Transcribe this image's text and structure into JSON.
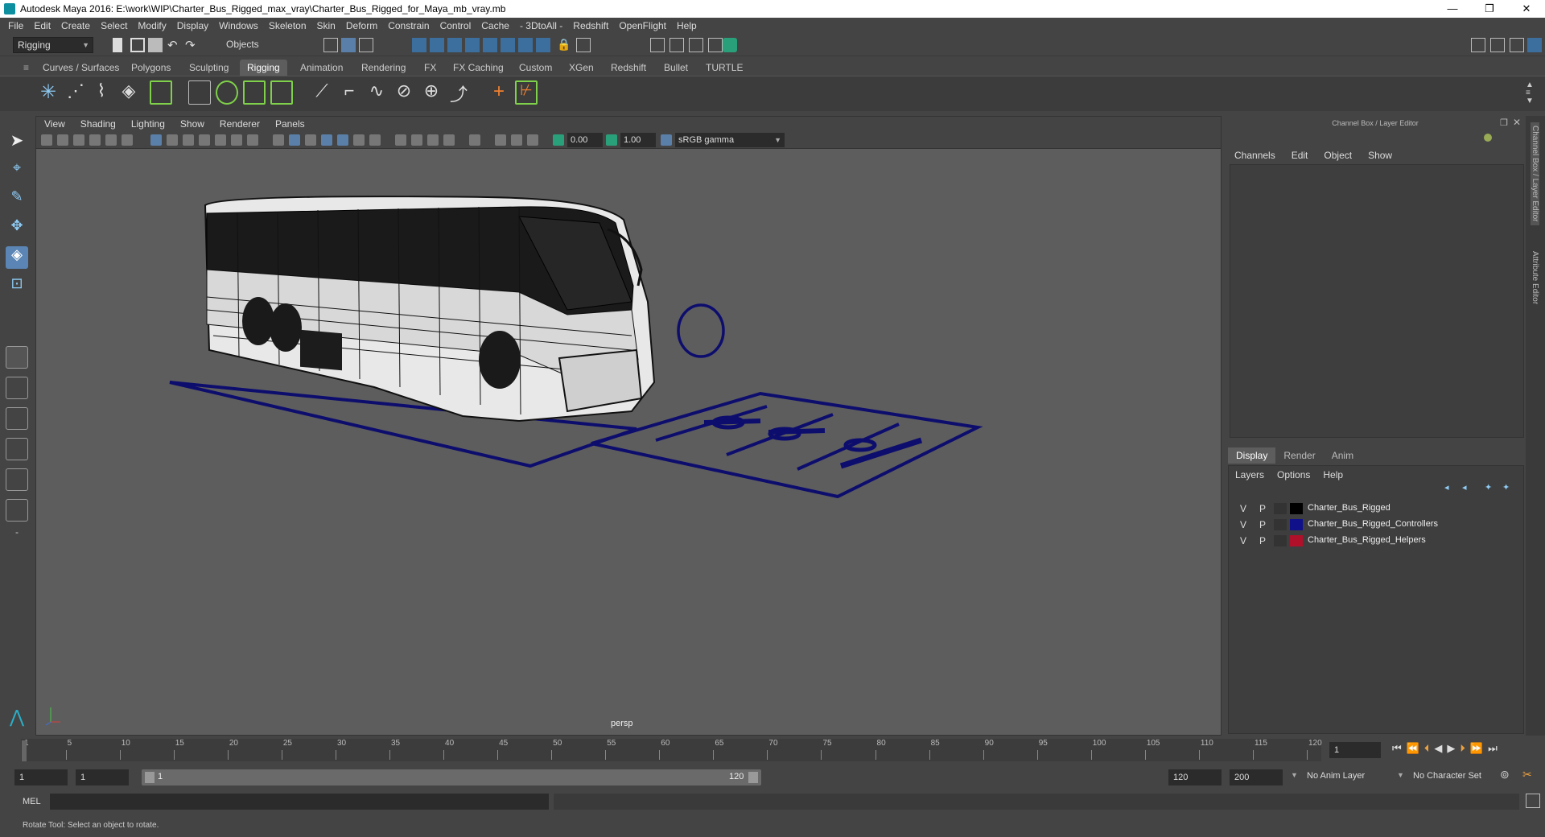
{
  "title_bar": {
    "text": "Autodesk Maya 2016: E:\\work\\WIP\\Charter_Bus_Rigged_max_vray\\Charter_Bus_Rigged_for_Maya_mb_vray.mb"
  },
  "menu": [
    "File",
    "Edit",
    "Create",
    "Select",
    "Modify",
    "Display",
    "Windows",
    "Skeleton",
    "Skin",
    "Deform",
    "Constrain",
    "Control",
    "Cache",
    "- 3DtoAll -",
    "Redshift",
    "OpenFlight",
    "Help"
  ],
  "status_line": {
    "menu_set": "Rigging",
    "selection_mode": "Objects"
  },
  "shelf_tabs": [
    "Curves / Surfaces",
    "Polygons",
    "Sculpting",
    "Rigging",
    "Animation",
    "Rendering",
    "FX",
    "FX Caching",
    "Custom",
    "XGen",
    "Redshift",
    "Bullet",
    "TURTLE"
  ],
  "active_shelf_tab": "Rigging",
  "viewport": {
    "menu": [
      "View",
      "Shading",
      "Lighting",
      "Show",
      "Renderer",
      "Panels"
    ],
    "exposure": "0.00",
    "gamma": "1.00",
    "color_space": "sRGB gamma",
    "camera_label": "persp",
    "wire_color": "#0d0d6e"
  },
  "channel_box": {
    "title": "Channel Box / Layer Editor",
    "menu": [
      "Channels",
      "Edit",
      "Object",
      "Show"
    ],
    "layer_tabs": [
      "Display",
      "Render",
      "Anim"
    ],
    "active_layer_tab": "Display",
    "layer_menu": [
      "Layers",
      "Options",
      "Help"
    ],
    "layers": [
      {
        "v": "V",
        "p": "P",
        "color": "#000000",
        "name": "Charter_Bus_Rigged"
      },
      {
        "v": "V",
        "p": "P",
        "color": "#10108a",
        "name": "Charter_Bus_Rigged_Controllers"
      },
      {
        "v": "V",
        "p": "P",
        "color": "#b0102a",
        "name": "Charter_Bus_Rigged_Helpers"
      }
    ],
    "side_tabs": [
      "Channel Box / Layer Editor",
      "Attribute Editor"
    ]
  },
  "time_slider": {
    "ticks": [
      "1",
      "5",
      "10",
      "15",
      "20",
      "25",
      "30",
      "35",
      "40",
      "45",
      "50",
      "55",
      "60",
      "65",
      "70",
      "75",
      "80",
      "85",
      "90",
      "95",
      "100",
      "105",
      "110",
      "115",
      "120"
    ],
    "current_frame": "1"
  },
  "range": {
    "start": "1",
    "playback_start": "1",
    "slider_start": "1",
    "slider_end": "120",
    "playback_end": "120",
    "end": "200",
    "anim_layer": "No Anim Layer",
    "character_set": "No Character Set"
  },
  "command_line": {
    "label": "MEL"
  },
  "help_line": {
    "text": "Rotate Tool: Select an object to rotate."
  }
}
